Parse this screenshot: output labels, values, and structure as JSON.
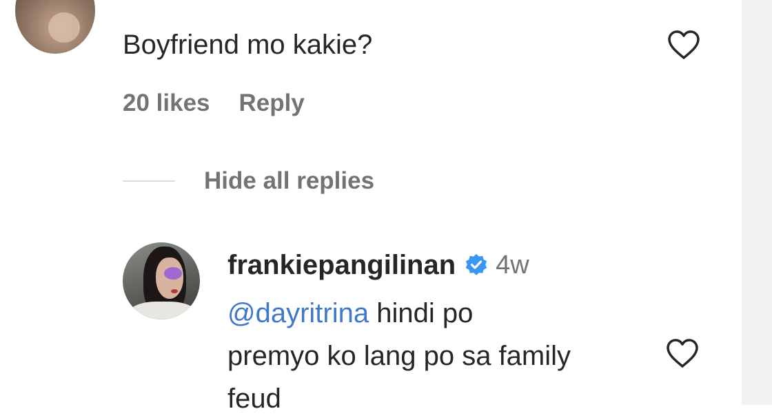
{
  "comment": {
    "text": "Boyfriend mo kakie?",
    "likes": "20 likes",
    "reply_label": "Reply",
    "like_icon": "heart-outline-icon"
  },
  "replies_toggle": {
    "label": "Hide all replies"
  },
  "reply": {
    "username": "frankiepangilinan",
    "verified_icon": "verified-badge-icon",
    "time": "4w",
    "mention": "@dayritrina",
    "text_line1": " hindi po",
    "text_line2": "premyo ko lang po sa family",
    "text_line3": "feud",
    "like_icon": "heart-outline-icon"
  },
  "colors": {
    "text": "#262626",
    "secondary": "#737373",
    "mention": "#3f78c9",
    "verified": "#3897f0",
    "divider": "#dbdbdb",
    "side_strip": "#f2f2f2"
  }
}
